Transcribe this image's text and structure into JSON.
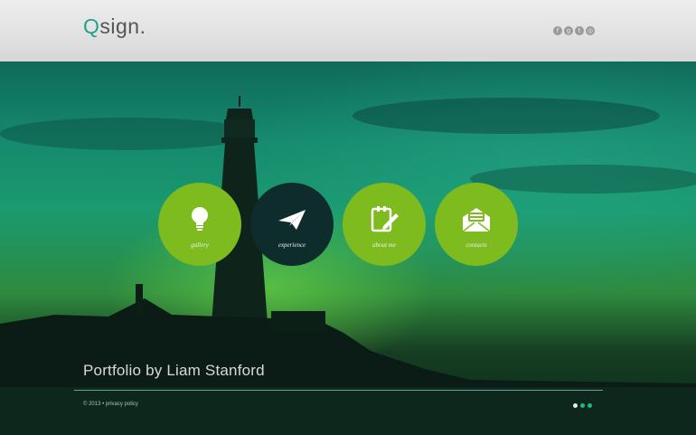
{
  "header": {
    "logo_q": "Q",
    "logo_rest": "sign.",
    "social": [
      {
        "icon": "facebook-icon",
        "glyph": "f"
      },
      {
        "icon": "google-plus-icon",
        "glyph": "g"
      },
      {
        "icon": "twitter-icon",
        "glyph": "t"
      },
      {
        "icon": "dribbble-icon",
        "glyph": "◎"
      }
    ]
  },
  "nav": [
    {
      "label": "gallery",
      "icon": "lightbulb-icon",
      "active": false
    },
    {
      "label": "experience",
      "icon": "paper-plane-icon",
      "active": true
    },
    {
      "label": "about me",
      "icon": "notepad-pencil-icon",
      "active": false
    },
    {
      "label": "contacts",
      "icon": "envelope-icon",
      "active": false
    }
  ],
  "hero": {
    "title": "Portfolio by Liam Stanford"
  },
  "footer": {
    "copyright": "© 2013 •",
    "privacy_link": "privacy policy",
    "slides_total": 3,
    "slide_active": 1
  },
  "colors": {
    "accent": "#7dbb1f",
    "active_circle": "#0e2c2c",
    "logo_q": "#19a58d"
  }
}
